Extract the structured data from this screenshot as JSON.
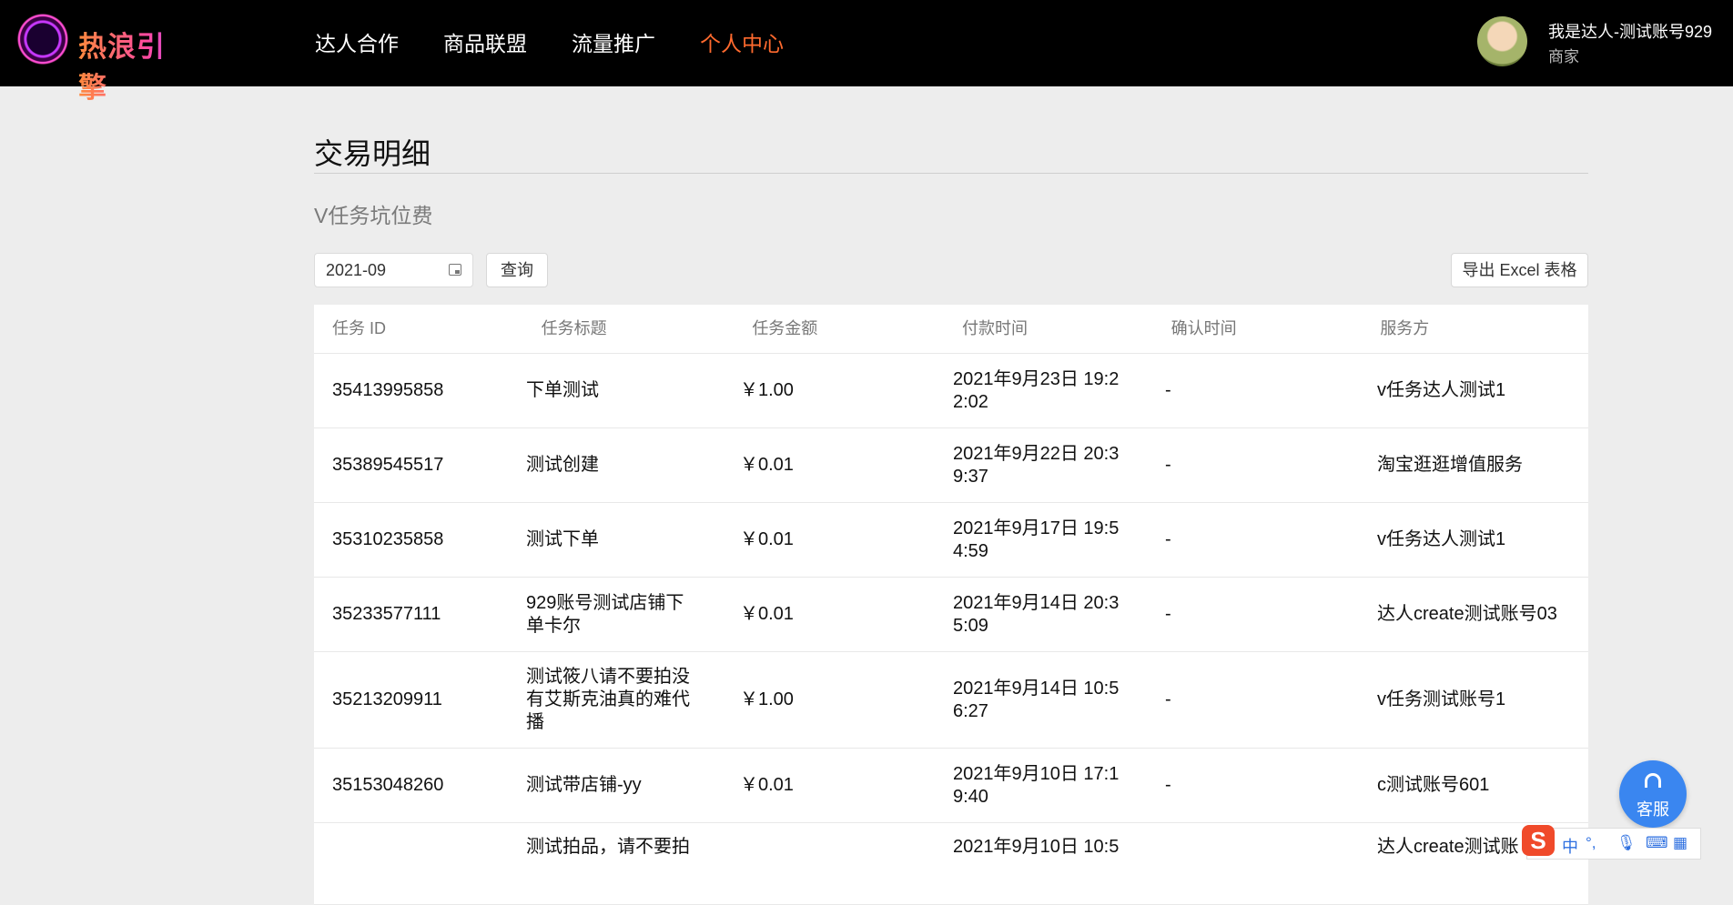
{
  "header": {
    "logo_text": "热浪引擎",
    "nav": [
      {
        "label": "达人合作",
        "active": false
      },
      {
        "label": "商品联盟",
        "active": false
      },
      {
        "label": "流量推广",
        "active": false
      },
      {
        "label": "个人中心",
        "active": true
      }
    ],
    "user": {
      "name": "我是达人-测试账号929",
      "role": "商家"
    },
    "accent_color": "#ff6a2e"
  },
  "page": {
    "title": "交易明细",
    "subtitle": "V任务坑位费"
  },
  "filters": {
    "month_value": "2021-09",
    "query_label": "查询",
    "export_label": "导出 Excel 表格"
  },
  "table": {
    "columns": [
      "任务 ID",
      "任务标题",
      "任务金额",
      "付款时间",
      "确认时间",
      "服务方"
    ],
    "rows": [
      {
        "id": "35413995858",
        "title": "下单测试",
        "amount": "￥1.00",
        "paid_at": "2021年9月23日 19:22:02",
        "confirmed_at": "-",
        "provider": "v任务达人测试1"
      },
      {
        "id": "35389545517",
        "title": "测试创建",
        "amount": "￥0.01",
        "paid_at": "2021年9月22日 20:39:37",
        "confirmed_at": "-",
        "provider": "淘宝逛逛增值服务"
      },
      {
        "id": "35310235858",
        "title": "测试下单",
        "amount": "￥0.01",
        "paid_at": "2021年9月17日 19:54:59",
        "confirmed_at": "-",
        "provider": "v任务达人测试1"
      },
      {
        "id": "35233577111",
        "title": "929账号测试店铺下单卡尔",
        "amount": "￥0.01",
        "paid_at": "2021年9月14日 20:35:09",
        "confirmed_at": "-",
        "provider": "达人create测试账号03"
      },
      {
        "id": "35213209911",
        "title": "测试筱八请不要拍没有艾斯克油真的难代播",
        "amount": "￥1.00",
        "paid_at": "2021年9月14日 10:56:27",
        "confirmed_at": "-",
        "provider": "v任务测试账号1"
      },
      {
        "id": "35153048260",
        "title": "测试带店铺-yy",
        "amount": "￥0.01",
        "paid_at": "2021年9月10日 17:19:40",
        "confirmed_at": "-",
        "provider": "c测试账号601"
      },
      {
        "id": "",
        "title": "测试拍品，请不要拍",
        "amount": "",
        "paid_at": "2021年9月10日 10:5",
        "confirmed_at": "",
        "provider": "达人create测试账"
      }
    ]
  },
  "service_button": {
    "label": "客服"
  },
  "ime": {
    "logo": "S",
    "lang": "中",
    "punct": "°,"
  }
}
